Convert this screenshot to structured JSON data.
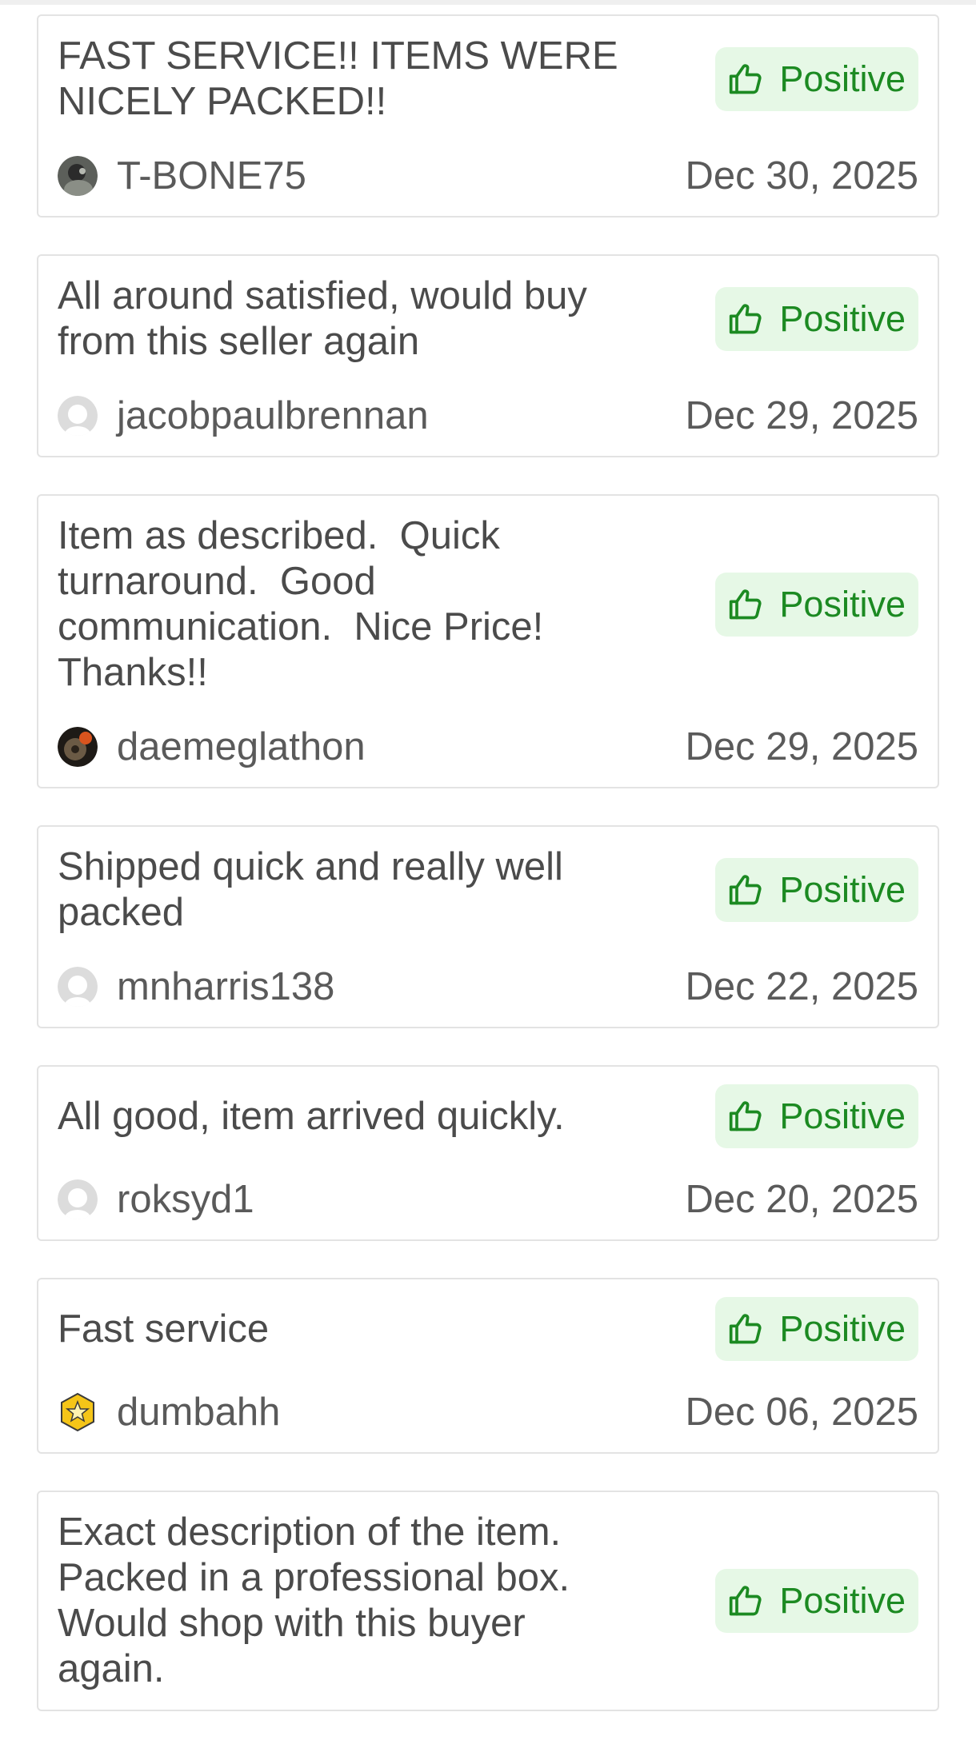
{
  "colors": {
    "positive_text": "#1c8a22",
    "positive_bg": "#e6f8e6",
    "card_border": "#e3e3e3",
    "text": "#4b4b4b"
  },
  "reviews": [
    {
      "comment": "FAST SERVICE!! ITEMS WERE\nNICELY PACKED!!",
      "rating": "Positive",
      "rating_icon": "thumbs-up-icon",
      "user": "T-BONE75",
      "avatar": "photo-avatar",
      "date": "Dec 30, 2025"
    },
    {
      "comment": "All around satisfied, would buy\nfrom this seller again",
      "rating": "Positive",
      "rating_icon": "thumbs-up-icon",
      "user": "jacobpaulbrennan",
      "avatar": "default-avatar",
      "date": "Dec 29, 2025"
    },
    {
      "comment": "Item as described.  Quick\nturnaround.  Good\ncommunication.  Nice Price!\nThanks!!",
      "rating": "Positive",
      "rating_icon": "thumbs-up-icon",
      "user": "daemeglathon",
      "avatar": "record-avatar",
      "date": "Dec 29, 2025"
    },
    {
      "comment": "Shipped quick and really well\npacked",
      "rating": "Positive",
      "rating_icon": "thumbs-up-icon",
      "user": "mnharris138",
      "avatar": "default-avatar",
      "date": "Dec 22, 2025"
    },
    {
      "comment": "All good, item arrived quickly.",
      "rating": "Positive",
      "rating_icon": "thumbs-up-icon",
      "user": "roksyd1",
      "avatar": "default-avatar",
      "date": "Dec 20, 2025"
    },
    {
      "comment": "Fast service",
      "rating": "Positive",
      "rating_icon": "thumbs-up-icon",
      "user": "dumbahh",
      "avatar": "star-badge-avatar",
      "date": "Dec 06, 2025"
    },
    {
      "comment": "Exact description of the item.\nPacked in a professional box.\nWould shop with this buyer\nagain.",
      "rating": "Positive",
      "rating_icon": "thumbs-up-icon",
      "user": "",
      "avatar": "",
      "date": ""
    }
  ]
}
